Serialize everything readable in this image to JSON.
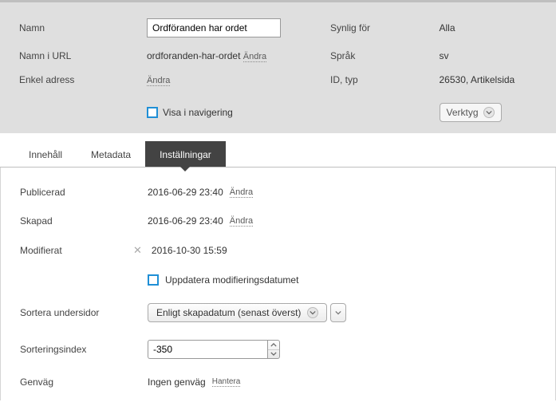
{
  "top": {
    "name_label": "Namn",
    "name_value": "Ordföranden har ordet",
    "url_name_label": "Namn i URL",
    "url_name_value": "ordforanden-har-ordet",
    "url_name_change": "Ändra",
    "simple_address_label": "Enkel adress",
    "simple_address_change": "Ändra",
    "visible_for_label": "Synlig för",
    "visible_for_value": "Alla",
    "language_label": "Språk",
    "language_value": "sv",
    "id_type_label": "ID, typ",
    "id_type_value": "26530, Artikelsida",
    "show_in_nav_label": "Visa i navigering",
    "tools_label": "Verktyg"
  },
  "tabs": {
    "content": "Innehåll",
    "metadata": "Metadata",
    "settings": "Inställningar"
  },
  "settings": {
    "published_label": "Publicerad",
    "published_value": "2016-06-29 23:40",
    "published_change": "Ändra",
    "created_label": "Skapad",
    "created_value": "2016-06-29 23:40",
    "created_change": "Ändra",
    "modified_label": "Modifierat",
    "modified_value": "2016-10-30 15:59",
    "update_modified_label": "Uppdatera modifieringsdatumet",
    "sort_subpages_label": "Sortera undersidor",
    "sort_subpages_value": "Enligt skapadatum (senast överst)",
    "sort_index_label": "Sorteringsindex",
    "sort_index_value": "-350",
    "shortcut_label": "Genväg",
    "shortcut_value": "Ingen genväg",
    "shortcut_manage": "Hantera"
  }
}
